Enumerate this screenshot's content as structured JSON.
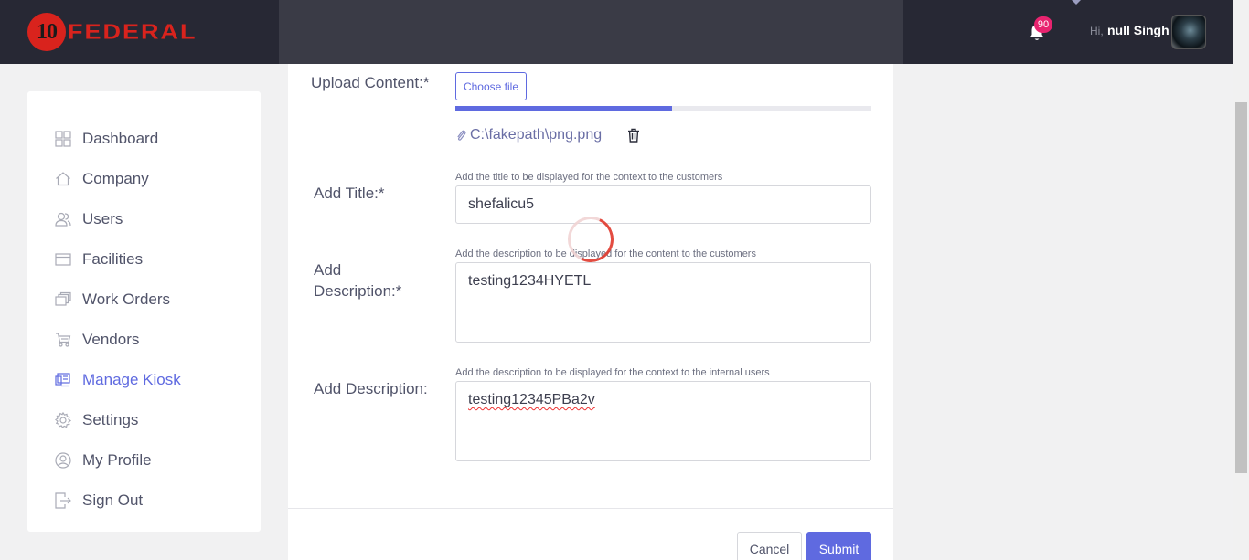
{
  "header": {
    "logo_number": "10",
    "logo_text": "FEDERAL",
    "notification_count": "90",
    "greeting": "Hi,",
    "user_name": "null Singh",
    "icons": {
      "notifications": "bell-icon",
      "avatar": "user-avatar"
    },
    "colors": {
      "bar": "#272834",
      "brand_red": "#d9231d",
      "badge": "#e8236f"
    }
  },
  "sidebar": {
    "items": [
      {
        "label": "Dashboard",
        "icon": "grid-icon",
        "active": false
      },
      {
        "label": "Company",
        "icon": "home-icon",
        "active": false
      },
      {
        "label": "Users",
        "icon": "users-icon",
        "active": false
      },
      {
        "label": "Facilities",
        "icon": "facilities-icon",
        "active": false
      },
      {
        "label": "Work Orders",
        "icon": "work-orders-icon",
        "active": false
      },
      {
        "label": "Vendors",
        "icon": "cart-icon",
        "active": false
      },
      {
        "label": "Manage Kiosk",
        "icon": "kiosk-icon",
        "active": true
      },
      {
        "label": "Settings",
        "icon": "gear-icon",
        "active": false
      },
      {
        "label": "My Profile",
        "icon": "profile-icon",
        "active": false
      },
      {
        "label": "Sign Out",
        "icon": "sign-out-icon",
        "active": false
      }
    ],
    "active_color": "#5f6ae0"
  },
  "form": {
    "upload": {
      "label": "Upload Content:*",
      "button_label": "Choose file",
      "progress_percent": 52,
      "file_name": "C:\\fakepath\\png.png"
    },
    "title": {
      "label": "Add Title:*",
      "hint": "Add the title to be displayed for the context to the customers",
      "value": "shefalicu5"
    },
    "description": {
      "label_line1": "Add",
      "label_line2": "Description:*",
      "hint": "Add the description to be displayed for the content to the customers",
      "value": "testing1234HYETL"
    },
    "internal_description": {
      "label": "Add Description:",
      "hint": "Add the description to be displayed for the context to the internal users",
      "value": "testing12345PBa2v"
    },
    "actions": {
      "cancel_label": "Cancel",
      "submit_label": "Submit"
    }
  }
}
